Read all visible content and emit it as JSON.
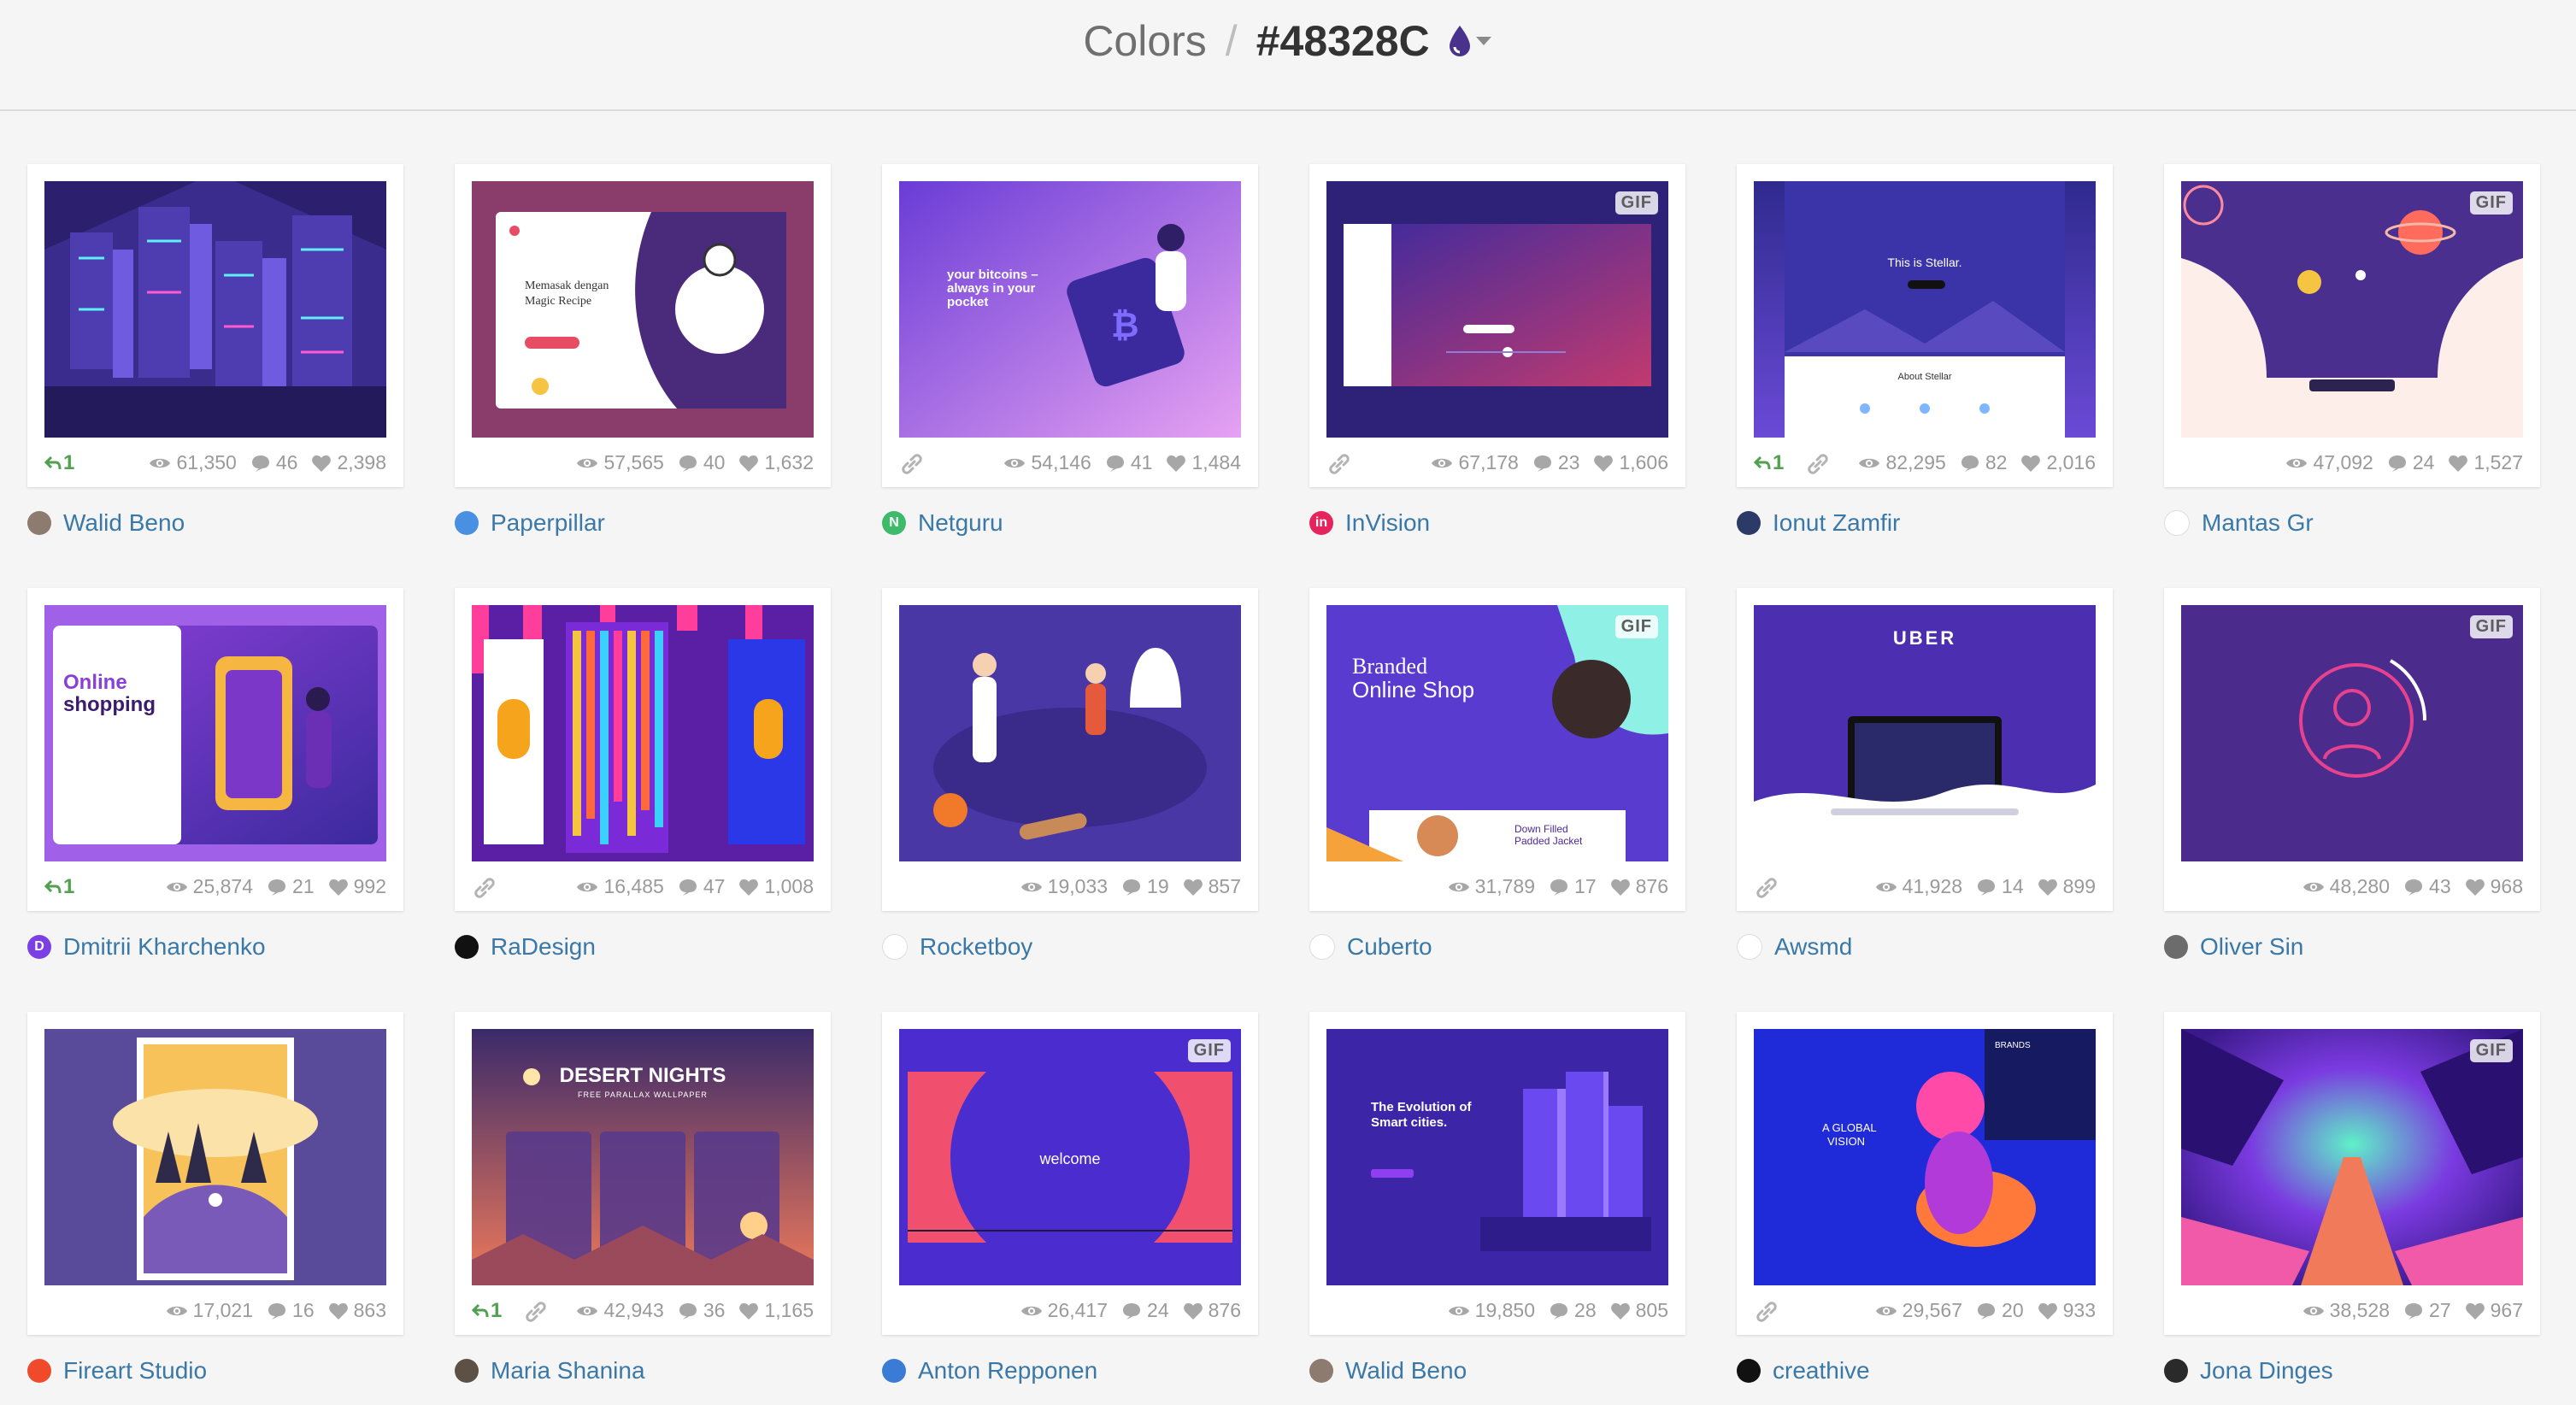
{
  "page": {
    "section": "Colors",
    "separator": "/",
    "color_hex": "#48328C",
    "color_swatch": "#48328C",
    "dropdown_icon": "color-drop-icon"
  },
  "gif_label": "GIF",
  "shots": [
    {
      "rebound": "1",
      "views": "61,350",
      "comments": "46",
      "likes": "2,398",
      "author": "Walid Beno",
      "av": "#8c7b6e",
      "av_letter": "",
      "scene": 0
    },
    {
      "views": "57,565",
      "comments": "40",
      "likes": "1,632",
      "author": "Paperpillar",
      "av": "#4a90e2",
      "av_letter": "",
      "scene": 1
    },
    {
      "link": true,
      "views": "54,146",
      "comments": "41",
      "likes": "1,484",
      "author": "Netguru",
      "av": "#3dbb6a",
      "av_letter": "N",
      "scene": 2
    },
    {
      "link": true,
      "gif": true,
      "views": "67,178",
      "comments": "23",
      "likes": "1,606",
      "author": "InVision",
      "av": "#e5245e",
      "av_letter": "in",
      "scene": 3
    },
    {
      "rebound": "1",
      "link": true,
      "views": "82,295",
      "comments": "82",
      "likes": "2,016",
      "author": "Ionut Zamfir",
      "av": "#2b3a67",
      "av_letter": "",
      "scene": 4
    },
    {
      "gif": true,
      "views": "47,092",
      "comments": "24",
      "likes": "1,527",
      "author": "Mantas Gr",
      "av": "#ffffff",
      "av_letter": "",
      "scene": 5
    },
    {
      "rebound": "1",
      "views": "25,874",
      "comments": "21",
      "likes": "992",
      "author": "Dmitrii Kharchenko",
      "av": "#7b3fe4",
      "av_letter": "D",
      "scene": 6
    },
    {
      "link": true,
      "views": "16,485",
      "comments": "47",
      "likes": "1,008",
      "author": "RaDesign",
      "av": "#111111",
      "av_letter": "",
      "scene": 7
    },
    {
      "views": "19,033",
      "comments": "19",
      "likes": "857",
      "author": "Rocketboy",
      "av": "#ffffff",
      "av_letter": "",
      "scene": 8
    },
    {
      "gif": true,
      "views": "31,789",
      "comments": "17",
      "likes": "876",
      "author": "Cuberto",
      "av": "#ffffff",
      "av_letter": "",
      "scene": 9
    },
    {
      "link": true,
      "views": "41,928",
      "comments": "14",
      "likes": "899",
      "author": "Awsmd",
      "av": "#ffffff",
      "av_letter": "",
      "scene": 10
    },
    {
      "gif": true,
      "views": "48,280",
      "comments": "43",
      "likes": "968",
      "author": "Oliver Sin",
      "av": "#6c6c6c",
      "av_letter": "",
      "scene": 11
    },
    {
      "views": "17,021",
      "comments": "16",
      "likes": "863",
      "author": "Fireart Studio",
      "av": "#ef4b2b",
      "av_letter": "",
      "scene": 12
    },
    {
      "rebound": "1",
      "link": true,
      "views": "42,943",
      "comments": "36",
      "likes": "1,165",
      "author": "Maria Shanina",
      "av": "#5d5045",
      "av_letter": "",
      "scene": 13
    },
    {
      "gif": true,
      "views": "26,417",
      "comments": "24",
      "likes": "876",
      "author": "Anton Repponen",
      "av": "#3a7bd5",
      "av_letter": "",
      "scene": 14
    },
    {
      "views": "19,850",
      "comments": "28",
      "likes": "805",
      "author": "Walid Beno",
      "av": "#8c7b6e",
      "av_letter": "",
      "scene": 15
    },
    {
      "link": true,
      "views": "29,567",
      "comments": "20",
      "likes": "933",
      "author": "creathive",
      "av": "#111111",
      "av_letter": "",
      "scene": 16
    },
    {
      "gif": true,
      "views": "38,528",
      "comments": "27",
      "likes": "967",
      "author": "Jona Dinges",
      "av": "#2a2a2a",
      "av_letter": "",
      "scene": 17
    }
  ],
  "thumb_text": {
    "s1": "Memasak dengan",
    "s1b": "Magic Recipe",
    "s2": "your bitcoins –",
    "s2b": "always in your",
    "s2c": "pocket",
    "s4": "This is Stellar.",
    "s4b": "About Stellar",
    "s6": "Online",
    "s6b": "shopping",
    "s9": "Branded",
    "s9b": "Online Shop",
    "s9c": "Down Filled",
    "s9d": "Padded Jacket",
    "s10": "UBER",
    "s13": "DESERT NIGHTS",
    "s13b": "FREE PARALLAX WALLPAPER",
    "s14": "welcome",
    "s15": "The Evolution of",
    "s15b": "Smart cities.",
    "s16": "A GLOBAL",
    "s16b": "VISION",
    "s16c": "BRANDS"
  }
}
